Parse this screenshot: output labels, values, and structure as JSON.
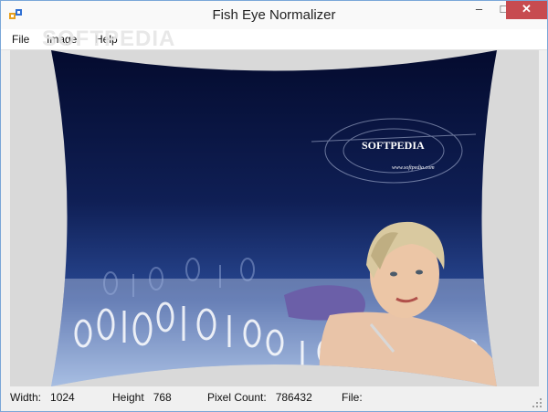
{
  "window": {
    "title": "Fish Eye Normalizer"
  },
  "title_controls": {
    "minimize": "–",
    "maximize": "□",
    "close": "✕"
  },
  "menu": {
    "file": "File",
    "image": "Image",
    "help": "Help"
  },
  "watermark": "SOFTPEDIA",
  "image": {
    "brand": "SOFTPEDIA",
    "url": "www.softpedia.com"
  },
  "status": {
    "width_label": "Width:",
    "width_value": "1024",
    "height_label": "Height",
    "height_value": "768",
    "pixel_label": "Pixel Count:",
    "pixel_value": "786432",
    "file_label": "File:",
    "file_value": ""
  },
  "colors": {
    "title_accent": "#7aa7d8",
    "close": "#c74b50",
    "sky_top": "#050d33",
    "sky_mid": "#1e3678"
  }
}
